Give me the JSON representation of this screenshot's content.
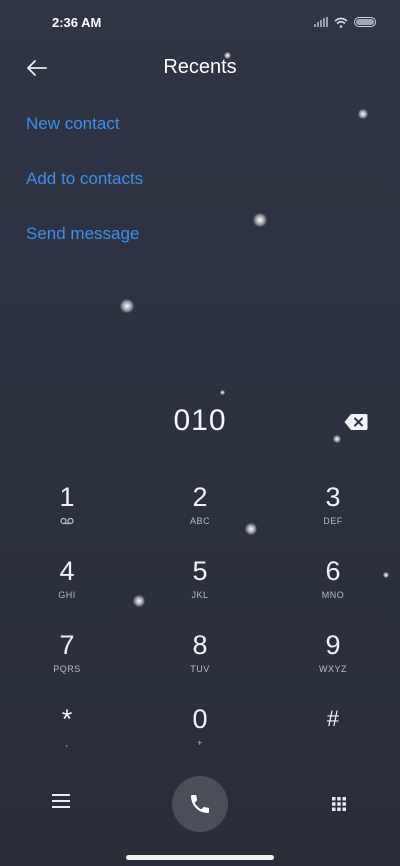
{
  "status": {
    "time": "2:36 AM"
  },
  "header": {
    "title": "Recents"
  },
  "actions": [
    "New contact",
    "Add to contacts",
    "Send message"
  ],
  "dialer": {
    "number": "010",
    "keys": [
      {
        "digit": "1",
        "letters": ""
      },
      {
        "digit": "2",
        "letters": "ABC"
      },
      {
        "digit": "3",
        "letters": "DEF"
      },
      {
        "digit": "4",
        "letters": "GHI"
      },
      {
        "digit": "5",
        "letters": "JKL"
      },
      {
        "digit": "6",
        "letters": "MNO"
      },
      {
        "digit": "7",
        "letters": "PQRS"
      },
      {
        "digit": "8",
        "letters": "TUV"
      },
      {
        "digit": "9",
        "letters": "WXYZ"
      },
      {
        "digit": "*",
        "letters": ","
      },
      {
        "digit": "0",
        "letters": "+"
      },
      {
        "digit": "#",
        "letters": ""
      }
    ]
  },
  "icons": {
    "back": "arrow-left-icon",
    "delete": "backspace-icon",
    "voicemail": "voicemail-icon",
    "menu": "hamburger-menu-icon",
    "call": "phone-icon",
    "keypad": "dialpad-grid-icon"
  },
  "colors": {
    "accent": "#3d8eea",
    "background": "#2c3241",
    "call_button": "#4a4e58"
  }
}
